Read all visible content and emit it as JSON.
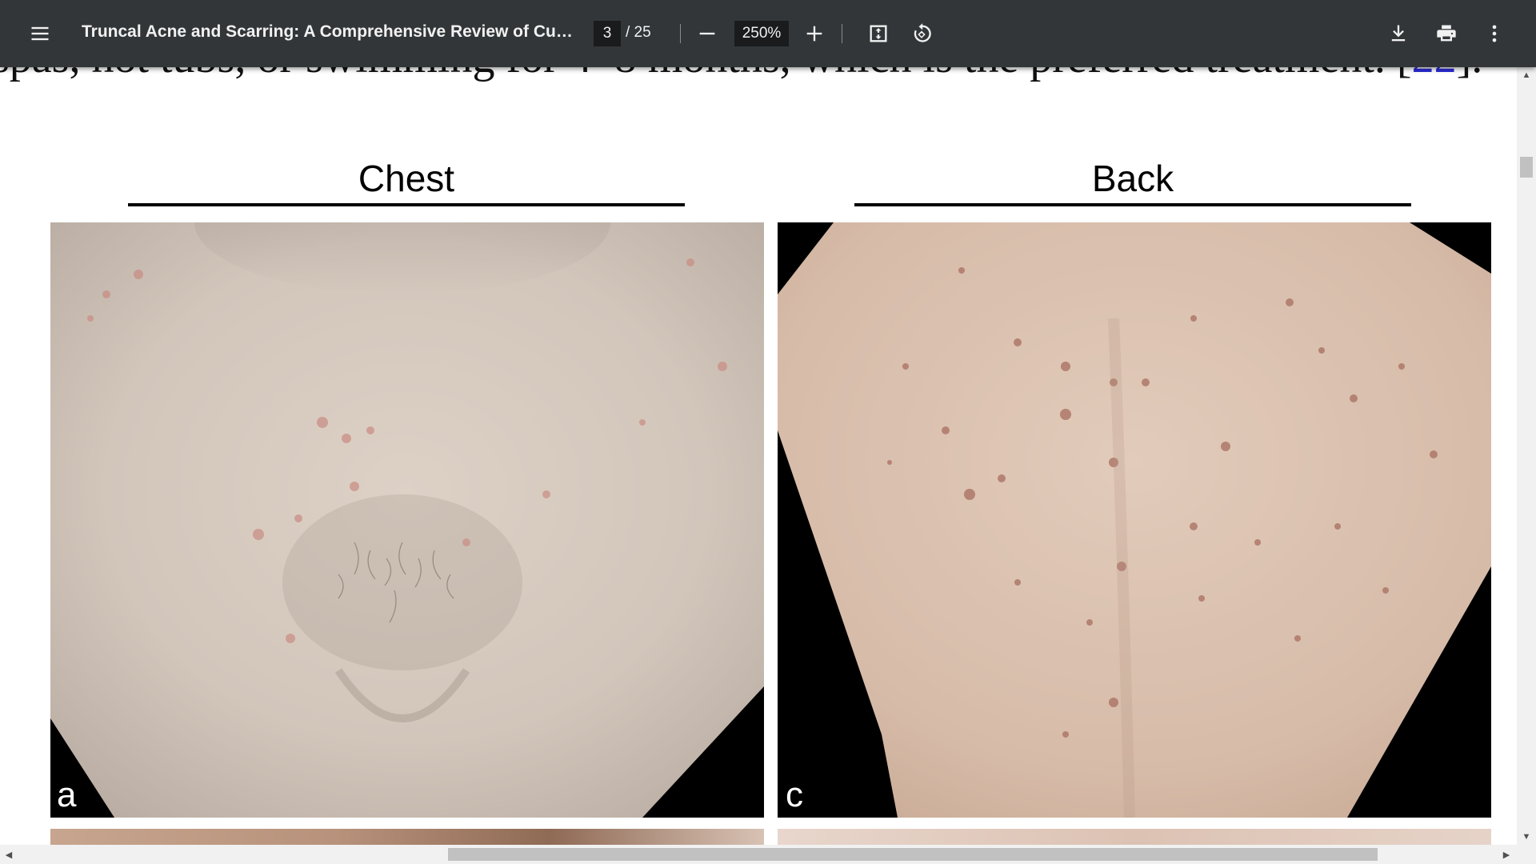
{
  "toolbar": {
    "title": "Truncal Acne and Scarring: A Comprehensive Review of Current...",
    "page_current": "3",
    "page_total": "/ 25",
    "zoom": "250%",
    "icons": [
      "menu-icon",
      "zoom-out-icon",
      "zoom-in-icon",
      "fit-page-icon",
      "rotate-icon",
      "download-icon",
      "print-icon",
      "more-options-icon"
    ]
  },
  "document": {
    "previous_line": "spas, hot tubs, or swimming   for 4–8 months, which is the preferred treatment. [",
    "previous_line_ref": "22",
    "previous_line_end": "].",
    "figure": {
      "chest_heading": "Chest",
      "back_heading": "Back",
      "panel_a_label": "a",
      "panel_c_label": "c"
    }
  },
  "colors": {
    "toolbar_bg": "#323639",
    "viewer_bg": "#525659",
    "page_bg": "#ffffff",
    "link": "#2b2bd6"
  }
}
